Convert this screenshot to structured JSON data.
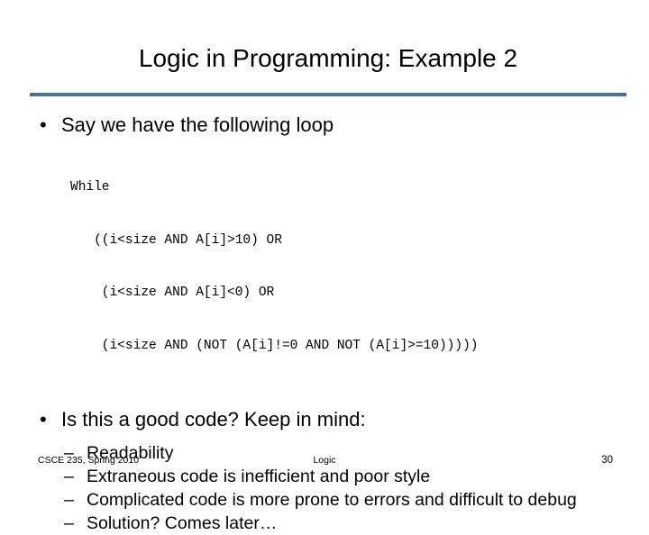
{
  "slide": {
    "title": "Logic in Programming: Example 2",
    "accent_color": "#4a7296",
    "background_color": "#ffffff",
    "text_color": "#000000"
  },
  "content": {
    "bullet1": {
      "marker": "•",
      "text": "Say we have the following loop"
    },
    "code": {
      "lines": [
        "While",
        "   ((i<size AND A[i]>10) OR",
        "    (i<size AND A[i]<0) OR",
        "    (i<size AND (NOT (A[i]!=0 AND NOT (A[i]>=10)))))"
      ]
    },
    "bullet2": {
      "marker": "•",
      "text": "Is this a good code? Keep in mind:"
    },
    "sub_bullets": [
      {
        "marker": "–",
        "text": "Readability"
      },
      {
        "marker": "–",
        "text": "Extraneous code is inefficient and poor style"
      },
      {
        "marker": "–",
        "text": "Complicated code is more prone to errors and difficult to debug"
      },
      {
        "marker": "–",
        "text": "Solution?  Comes later…"
      }
    ]
  },
  "footer": {
    "course": "CSCE 235, Spring 2010",
    "topic": "Logic",
    "page_number": "30"
  }
}
